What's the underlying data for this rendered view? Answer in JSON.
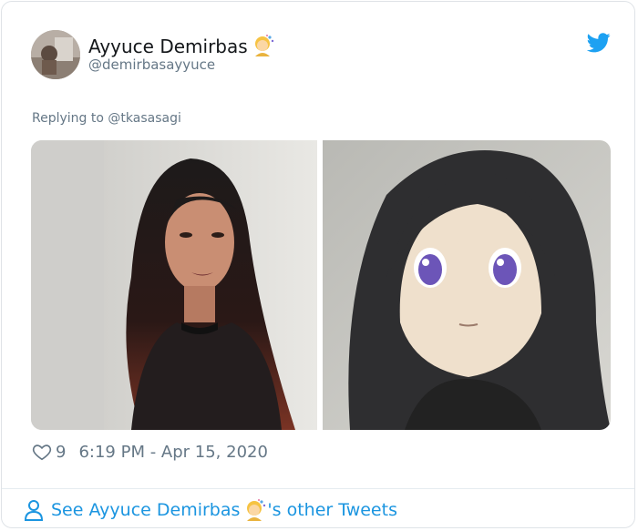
{
  "tweet": {
    "author_name": "Ayyuce Demirbas",
    "author_handle": "@demirbasayyuce",
    "replying_prefix": "Replying to",
    "replying_to": "@tkasasagi",
    "like_count": "9",
    "timestamp": "6:19 PM - Apr 15, 2020",
    "see_more_prefix": "See Ayyuce Demirbas",
    "see_more_suffix": "'s other Tweets"
  },
  "icons": {
    "brand": "twitter-bird-icon",
    "like": "heart-icon",
    "profile": "person-icon",
    "name_emoji": "woman-artist-emoji"
  },
  "colors": {
    "accent": "#1da1f2",
    "link": "#1b95e0",
    "secondary_text": "#657786",
    "primary_text": "#14171a"
  }
}
